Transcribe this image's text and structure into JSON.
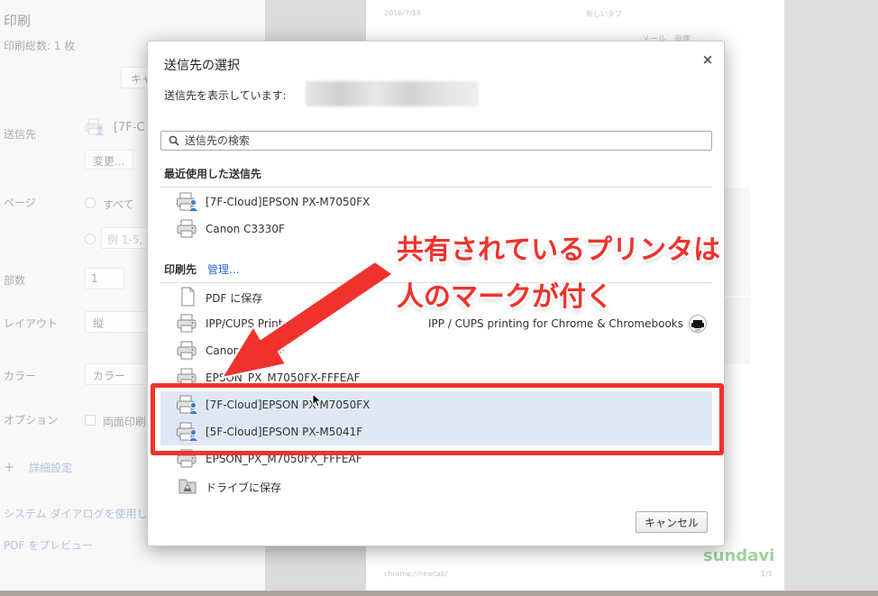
{
  "background": {
    "panel_title": "印刷",
    "total_pages": "印刷総数: 1 枚",
    "cancel_partial": "キャ",
    "destination_label": "送信先",
    "destination_value": "[7F-C",
    "change_button": "変更...",
    "pages_label": "ページ",
    "pages_all": "すべて",
    "pages_example": "例 1-5, 8",
    "copies_label": "部数",
    "copies_value": "1",
    "layout_label": "レイアウト",
    "layout_value": "縦",
    "color_label": "カラー",
    "color_value": "カラー",
    "options_label": "オプション",
    "duplex_label": "両面印刷",
    "advanced_label": "詳細設定",
    "system_dialog_link": "システム ダイアログを使用し",
    "pdf_preview_link": "PDF をプレビュー",
    "preview_date": "2016/7/18",
    "preview_tab": "新しいタブ",
    "preview_header": "メール　画像",
    "preview_footer": "chrome://newtab/",
    "preview_page_num": "1/1",
    "preview_logo": "sundavi"
  },
  "dialog": {
    "title": "送信先の選択",
    "close_symbol": "×",
    "showing_label": "送信先を表示しています:",
    "search_placeholder": "送信先の検索",
    "recent_title": "最近使用した送信先",
    "recent": [
      {
        "label": "[7F-Cloud]EPSON PX-M7050FX",
        "icon": "shared-printer-icon"
      },
      {
        "label": "Canon C3330F",
        "icon": "printer-icon"
      }
    ],
    "printers_title": "印刷先",
    "manage_link": "管理...",
    "printers": [
      {
        "label": "PDF に保存",
        "icon": "document-icon"
      },
      {
        "label": "IPP/CUPS Printer",
        "icon": "printer-icon",
        "desc": "IPP / CUPS printing for Chrome & Chromebooks"
      },
      {
        "label": "Canon C3330F",
        "icon": "printer-icon"
      },
      {
        "label": "EPSON_PX_M7050FX-FFFEAF",
        "icon": "printer-icon"
      },
      {
        "label": "[7F-Cloud]EPSON PX-M7050FX",
        "icon": "shared-printer-icon",
        "selected": true
      },
      {
        "label": "[5F-Cloud]EPSON PX-M5041F",
        "icon": "shared-printer-icon",
        "selected": true
      },
      {
        "label": "EPSON_PX_M7050FX_FFFEAF",
        "icon": "printer-icon"
      },
      {
        "label": "ドライブに保存",
        "icon": "drive-icon"
      }
    ],
    "cancel_button": "キャンセル"
  },
  "annotation": {
    "line1": "共有されているプリンタは",
    "line2": "人のマークが付く",
    "color": "#f0322d"
  }
}
